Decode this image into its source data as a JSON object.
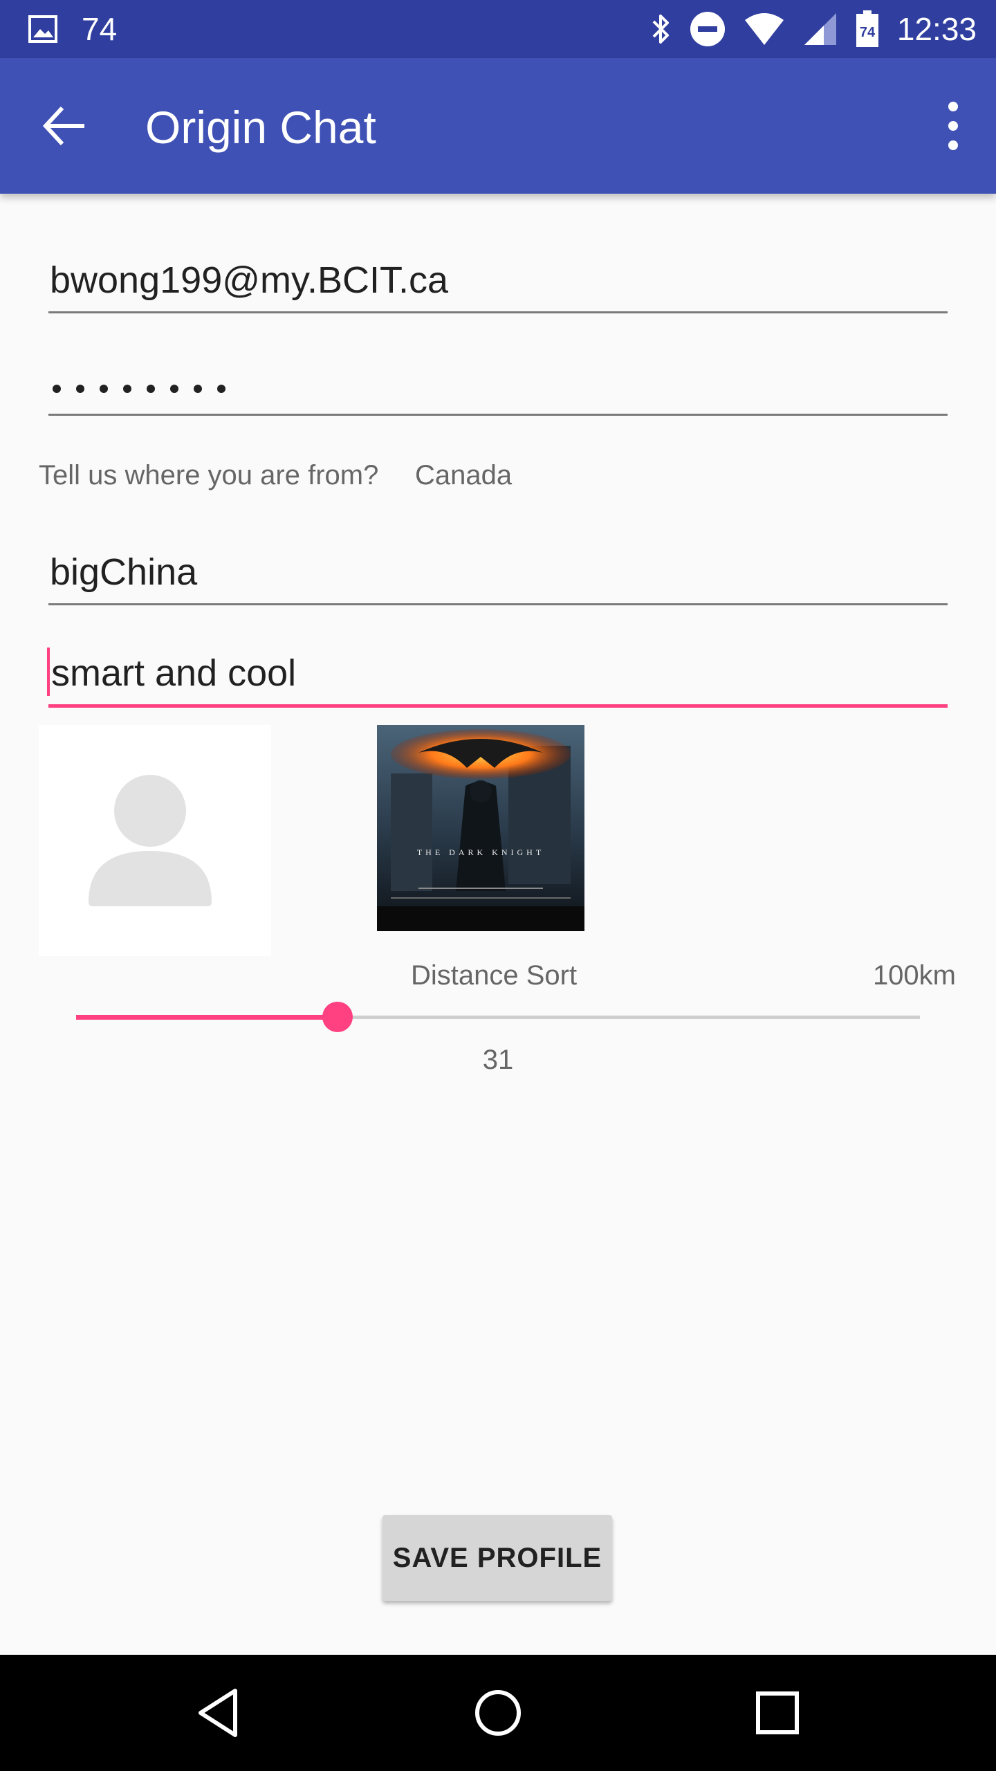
{
  "status_bar": {
    "left_value": "74",
    "time": "12:33",
    "battery_level": "74",
    "icons": [
      "image-icon",
      "bluetooth-icon",
      "do-not-disturb-icon",
      "wifi-icon",
      "cell-signal-icon",
      "battery-icon"
    ]
  },
  "app_bar": {
    "title": "Origin Chat",
    "back_icon": "arrow-back-icon",
    "menu_icon": "more-vert-icon",
    "color": "#3f51b5",
    "status_color": "#303f9f"
  },
  "form": {
    "email_value": "bwong199@my.BCIT.ca",
    "password_length": 8,
    "country_prompt": "Tell us where you are from?",
    "country_value": "Canada",
    "username_value": "bigChina",
    "description_value": "smart and cool"
  },
  "images": {
    "avatar_icon": "person-placeholder-icon",
    "album_title": "THE DARK KNIGHT"
  },
  "distance": {
    "label": "Distance Sort",
    "max_label": "100km",
    "value": "31",
    "max": 100,
    "accent_color": "#ff4081"
  },
  "actions": {
    "save_label": "SAVE PROFILE"
  },
  "nav_bar": {
    "icons": [
      "nav-back-icon",
      "nav-home-icon",
      "nav-recents-icon"
    ]
  }
}
